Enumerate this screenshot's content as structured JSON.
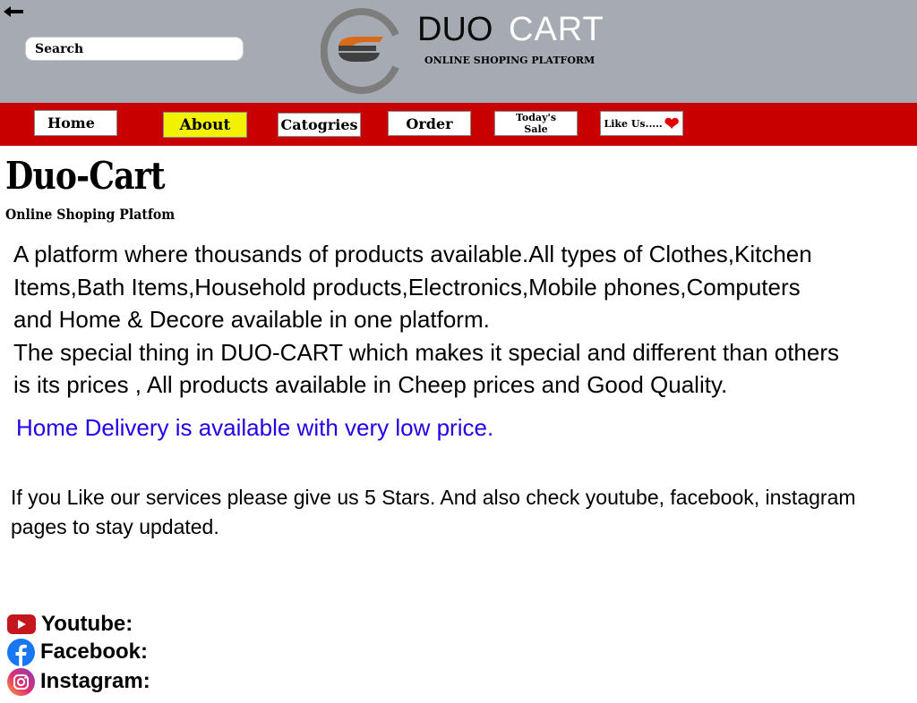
{
  "header": {
    "search_placeholder": "Search",
    "brand_first": "DUO",
    "brand_second": "CART",
    "tagline": "ONLINE SHOPING PLATFORM"
  },
  "nav": {
    "home": "Home",
    "about": "About",
    "categories": "Catogries",
    "order": "Order",
    "sale_line1": "Today's",
    "sale_line2": "Sale",
    "like": "Like Us....."
  },
  "main": {
    "title": "Duo-Cart",
    "subtitle": "Online Shoping Platfom",
    "paragraph_lines": [
      "A platform where thousands of products available.All types of Clothes,Kitchen",
      "Items,Bath Items,Household products,Electronics,Mobile phones,Computers",
      "and Home & Decore available in one platform.",
      "The special thing in DUO-CART which makes it special and different than others",
      "is its prices , All products available in Cheep prices and Good Quality."
    ],
    "delivery": "Home Delivery is available with very low price.",
    "rate_line1": "If you Like our services please give us 5 Stars. And  also check youtube, facebook, instagram",
    "rate_line2": "pages to stay updated."
  },
  "social": {
    "youtube": "Youtube:",
    "facebook": "Facebook:",
    "instagram": "Instagram:"
  },
  "colors": {
    "header_bg": "#a6aab2",
    "nav_bg": "#c90000",
    "about_highlight": "#f2f200",
    "delivery_text": "#2200e8"
  },
  "icons": [
    "back-arrow-icon",
    "brand-logo-icon",
    "heart-icon",
    "youtube-icon",
    "facebook-icon",
    "instagram-icon"
  ]
}
